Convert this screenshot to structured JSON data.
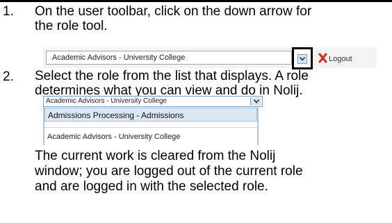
{
  "steps": [
    {
      "number": "1.",
      "lines": [
        "On the user toolbar, click on the down arrow for",
        "the role tool."
      ]
    },
    {
      "number": "2.",
      "lines": [
        "Select the role from the list that displays. A role",
        "determines what you can view and do in Nolij."
      ]
    }
  ],
  "toolbar": {
    "role_value": "Academic Advisors - University College",
    "dropdown_icon": "chevron-down-icon",
    "logout_label": "Logout",
    "logout_icon": "red-x-icon"
  },
  "role_dropdown": {
    "selected_value": "Academic Advisors - University College",
    "options": [
      "Admissions Processing - Admissions",
      "Academic Advisors - University College"
    ]
  },
  "result_text": [
    "The current work is cleared from the Nolij",
    "window; you are logged out of the current role",
    "and are logged in with the selected role."
  ],
  "colors": {
    "highlight_row": "#dce8f5",
    "logout_icon": "#d62b1e",
    "arrow": "#1f3f75"
  }
}
